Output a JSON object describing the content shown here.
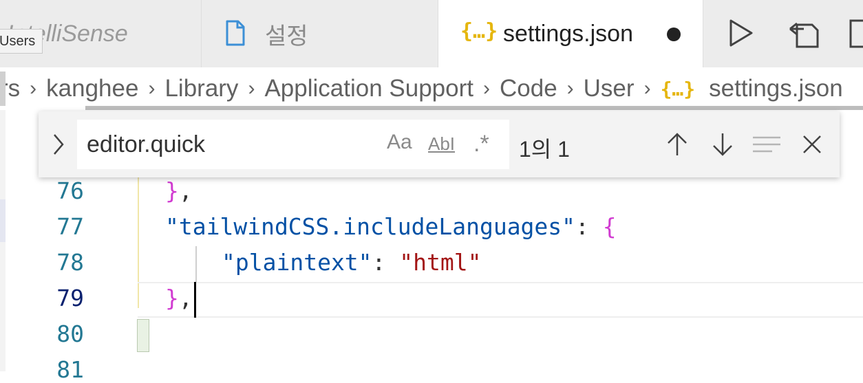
{
  "tabs": [
    {
      "label": "IntelliSense"
    },
    {
      "label": "설정"
    },
    {
      "label": "settings.json",
      "icon": "{…}"
    }
  ],
  "tooltip": "Users",
  "breadcrumb": {
    "items": [
      "rs",
      "kanghee",
      "Library",
      "Application Support",
      "Code",
      "User"
    ],
    "separator": "›",
    "file_icon": "{…}",
    "file": "settings.json"
  },
  "find": {
    "value": "editor.quick",
    "match_case": "Aa",
    "whole_word": "AbI",
    "regex": ".*",
    "count": "1의 1"
  },
  "editor": {
    "line_numbers": [
      "76",
      "77",
      "78",
      "79",
      "80",
      "81"
    ],
    "lines": {
      "l76": {
        "brace": "}",
        "punct": ","
      },
      "l77": {
        "key": "\"tailwindCSS.includeLanguages\"",
        "colon": ": ",
        "brace": "{"
      },
      "l78": {
        "key": "\"plaintext\"",
        "colon": ": ",
        "value": "\"html\""
      },
      "l79": {
        "brace": "}",
        "punct": ","
      },
      "l80": {
        "brace": "}"
      }
    }
  },
  "colors": {
    "json_key": "#0451a5",
    "json_string": "#a31515",
    "bracket": "#d13bd1",
    "bracket_outer": "#d4b40a",
    "line_number": "#237893"
  }
}
